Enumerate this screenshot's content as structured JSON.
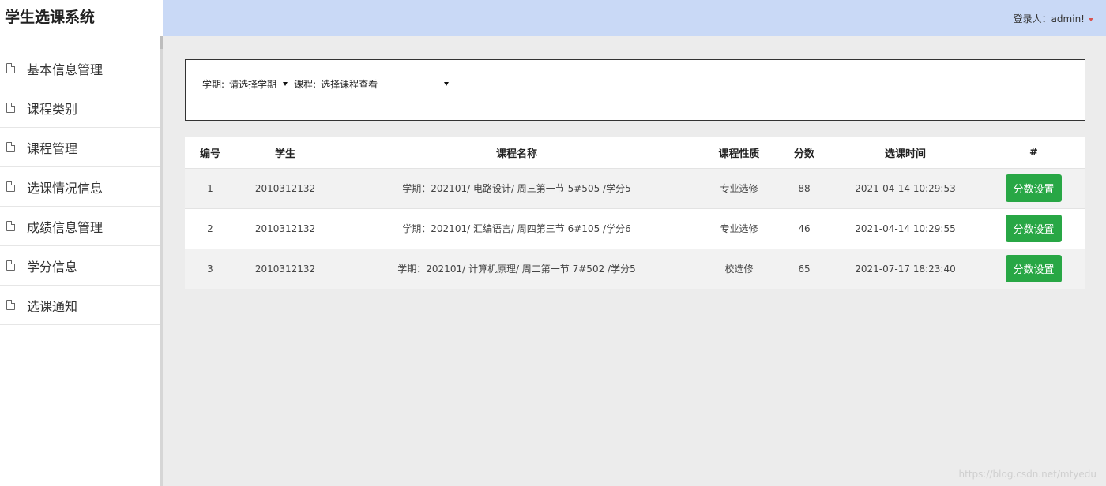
{
  "app": {
    "title": "学生选课系统"
  },
  "header": {
    "user_text": "登录人：admin!"
  },
  "sidebar": {
    "items": [
      {
        "label": "基本信息管理"
      },
      {
        "label": "课程类别"
      },
      {
        "label": "课程管理"
      },
      {
        "label": "选课情况信息"
      },
      {
        "label": "成绩信息管理"
      },
      {
        "label": "学分信息"
      },
      {
        "label": "选课通知"
      }
    ]
  },
  "filter": {
    "term_label": "学期:",
    "term_value": "请选择学期",
    "course_label": "课程:",
    "course_value": "选择课程查看"
  },
  "table": {
    "headers": [
      "编号",
      "学生",
      "课程名称",
      "课程性质",
      "分数",
      "选课时间",
      "#"
    ],
    "rows": [
      {
        "no": "1",
        "student": "2010312132",
        "course": "学期：202101/ 电路设计/ 周三第一节 5#505 /学分5",
        "nature": "专业选修",
        "score": "88",
        "time": "2021-04-14 10:29:53",
        "action": "分数设置"
      },
      {
        "no": "2",
        "student": "2010312132",
        "course": "学期：202101/ 汇编语言/ 周四第三节 6#105 /学分6",
        "nature": "专业选修",
        "score": "46",
        "time": "2021-04-14 10:29:55",
        "action": "分数设置"
      },
      {
        "no": "3",
        "student": "2010312132",
        "course": "学期：202101/ 计算机原理/ 周二第一节 7#502 /学分5",
        "nature": "校选修",
        "score": "65",
        "time": "2021-07-17 18:23:40",
        "action": "分数设置"
      }
    ]
  },
  "watermark": "https://blog.csdn.net/mtyedu",
  "colors": {
    "header_bg": "#c9d9f6",
    "button_green": "#28a745",
    "caret_red": "#d9534f"
  },
  "icons": {
    "menu_item": "document-icon",
    "user_menu": "caret-down-icon",
    "select": "caret-down-icon"
  }
}
